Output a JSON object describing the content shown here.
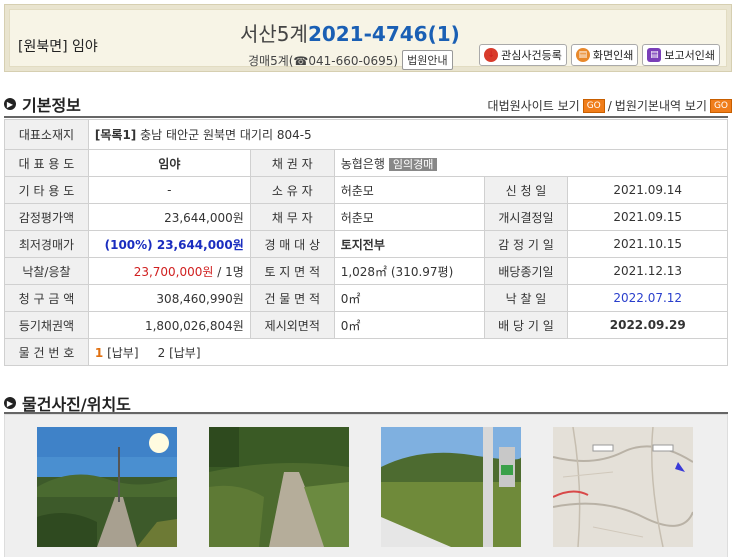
{
  "header": {
    "region": "[원북면] 임야",
    "court_branch": "서산5계",
    "case_number": "2021-4746(1)",
    "court_contact": "경매5계(☎041-660-0695)",
    "court_guide_label": "법원안내",
    "actions": [
      "관심사건등록",
      "화면인쇄",
      "보고서인쇄"
    ]
  },
  "basic": {
    "title": "기본정보",
    "link1": "대법원사이트 보기",
    "link2": "법원기본내역 보기",
    "go_label": "GO",
    "separator": "/"
  },
  "table": {
    "address_label": "대표소재지",
    "address_prefix": "[목록1]",
    "address": "충남 태안군 원북면 대기리 804-5",
    "row_use": {
      "label": "대 표 용 도",
      "value": "임야",
      "label2": "채 권 자",
      "value2": "농협은행",
      "tag": "임의경매"
    },
    "rows": [
      {
        "l1": "기 타 용 도",
        "v1": "-",
        "l2": "소 유 자",
        "v2": "허춘모",
        "l3": "신 청 일",
        "v3": "2021.09.14"
      },
      {
        "l1": "감정평가액",
        "v1": "23,644,000원",
        "l2": "채 무 자",
        "v2": "허춘모",
        "l3": "개시결정일",
        "v3": "2021.09.15"
      },
      {
        "l1": "최저경매가",
        "v1": "(100%) 23,644,000원",
        "l2": "경 매 대 상",
        "v2": "토지전부",
        "l3": "감 정 기 일",
        "v3": "2021.10.15"
      },
      {
        "l1": "낙찰/응찰",
        "v1": "23,700,000원",
        "v1b": "/ 1명",
        "l2": "토 지 면 적",
        "v2": "1,028㎡ (310.97평)",
        "l3": "배당종기일",
        "v3": "2021.12.13"
      },
      {
        "l1": "청 구 금 액",
        "v1": "308,460,990원",
        "l2": "건 물 면 적",
        "v2": "0㎡",
        "l3": "낙 찰 일",
        "v3": "2022.07.12"
      },
      {
        "l1": "등기채권액",
        "v1": "1,800,026,804원",
        "l2": "제시외면적",
        "v2": "0㎡",
        "l3": "배 당 기 일",
        "v3": "2022.09.29"
      }
    ],
    "items_label": "물 건 번 호",
    "item1_num": "1",
    "item1_status": "[납부]",
    "item2_num": "2",
    "item2_status": "[납부]"
  },
  "photos_section": {
    "title": "물건사진/위치도"
  }
}
